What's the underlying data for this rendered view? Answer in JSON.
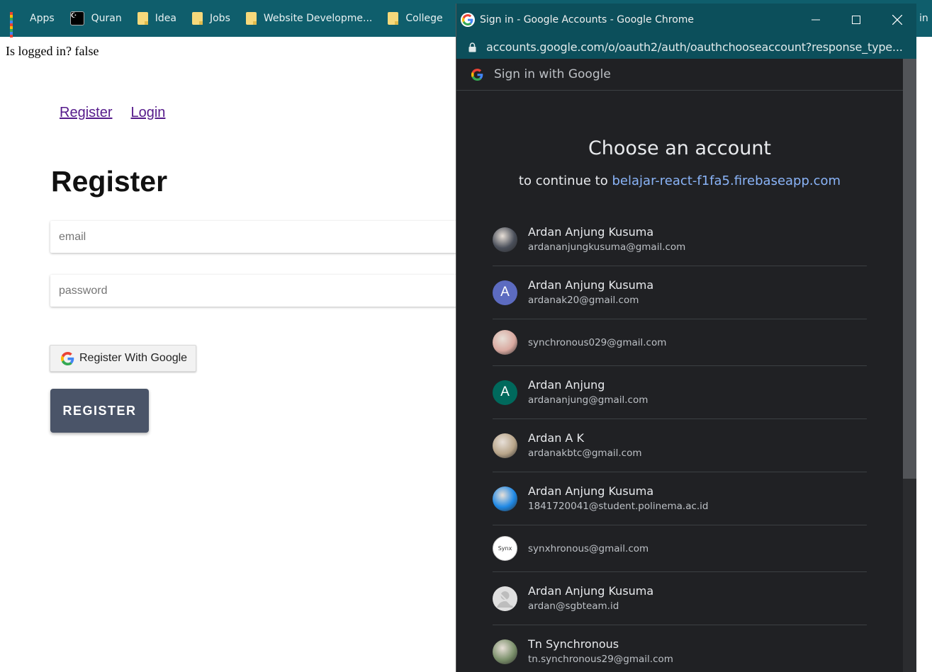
{
  "bookmarks": [
    {
      "label": "Apps",
      "icon": "apps-grid-icon"
    },
    {
      "label": "Quran",
      "icon": "quran-icon"
    },
    {
      "label": "Idea",
      "icon": "folder-icon"
    },
    {
      "label": "Jobs",
      "icon": "folder-icon"
    },
    {
      "label": "Website Developme...",
      "icon": "folder-icon"
    },
    {
      "label": "College",
      "icon": "folder-icon"
    }
  ],
  "bookmarks_overflow_text": "in X",
  "page": {
    "login_status": "Is logged in? false",
    "nav": {
      "register": "Register",
      "login": "Login"
    },
    "title": "Register",
    "email_placeholder": "email",
    "password_placeholder": "password",
    "google_button": "Register With Google",
    "register_button": "REGISTER"
  },
  "popup": {
    "window_title": "Sign in - Google Accounts - Google Chrome",
    "url": "accounts.google.com/o/oauth2/auth/oauthchooseaccount?response_type...",
    "header": "Sign in with Google",
    "heading": "Choose an account",
    "continue_prefix": "to continue to",
    "continue_site": "belajar-react-f1fa5.firebaseapp.com",
    "accounts": [
      {
        "name": "Ardan Anjung Kusuma",
        "email": "ardananjungkusuma@gmail.com",
        "avatar": "photo",
        "avatar_color": "#4a4f5a"
      },
      {
        "name": "Ardan Anjung Kusuma",
        "email": "ardanak20@gmail.com",
        "avatar": "letter",
        "letter": "A",
        "avatar_color": "#5c6bc0"
      },
      {
        "name": "",
        "email": "synchronous029@gmail.com",
        "avatar": "photo",
        "avatar_color": "#d9a9a0"
      },
      {
        "name": "Ardan Anjung",
        "email": "ardananjung@gmail.com",
        "avatar": "letter",
        "letter": "A",
        "avatar_color": "#00695c"
      },
      {
        "name": "Ardan A K",
        "email": "ardanakbtc@gmail.com",
        "avatar": "photo",
        "avatar_color": "#b8a58a"
      },
      {
        "name": "Ardan Anjung Kusuma",
        "email": "1841720041@student.polinema.ac.id",
        "avatar": "photo",
        "avatar_color": "#1e88e5"
      },
      {
        "name": "",
        "email": "synxhronous@gmail.com",
        "avatar": "logo",
        "avatar_color": "#ffffff",
        "logo_text": "Synx"
      },
      {
        "name": "Ardan Anjung Kusuma",
        "email": "ardan@sgbteam.id",
        "avatar": "default",
        "avatar_color": "#e0e0e0"
      },
      {
        "name": "Tn Synchronous",
        "email": "tn.synchronous29@gmail.com",
        "avatar": "photo",
        "avatar_color": "#7a8f6a"
      }
    ]
  },
  "colors": {
    "bookmark_bar": "#0f5e6c",
    "popup_bg": "#202124",
    "link_blue": "#8ab4f8",
    "register_button": "#4a5468",
    "visited_link": "#551a8b"
  }
}
